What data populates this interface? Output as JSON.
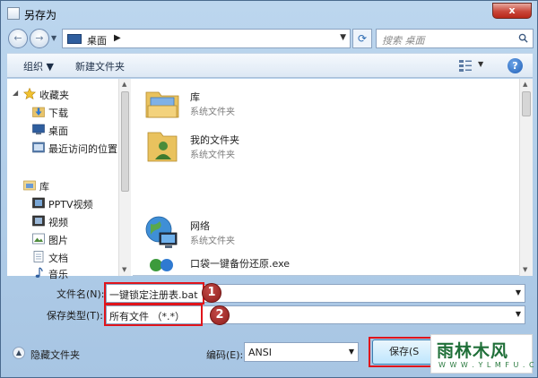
{
  "window": {
    "title": "另存为",
    "close_label": "x"
  },
  "address": {
    "back_label": "←",
    "forward_label": "→",
    "path": "桌面",
    "separator": "▶",
    "search_placeholder": "搜索 桌面"
  },
  "toolbar": {
    "organize": "组织 ▼",
    "new_folder": "新建文件夹",
    "help": "?"
  },
  "nav_pane": {
    "items": [
      {
        "label": "收藏夹",
        "icon": "star-icon"
      },
      {
        "label": "下载",
        "icon": "download-folder-icon"
      },
      {
        "label": "桌面",
        "icon": "desktop-icon"
      },
      {
        "label": "最近访问的位置",
        "icon": "recent-places-icon"
      },
      {
        "label": "库",
        "icon": "library-icon"
      },
      {
        "label": "PPTV视频",
        "icon": "video-folder-icon"
      },
      {
        "label": "视频",
        "icon": "video-icon"
      },
      {
        "label": "图片",
        "icon": "pictures-icon"
      },
      {
        "label": "文档",
        "icon": "documents-icon"
      },
      {
        "label": "音乐",
        "icon": "music-icon"
      }
    ]
  },
  "files": [
    {
      "name": "库",
      "type": "系统文件夹",
      "icon": "library-folder-icon"
    },
    {
      "name": "我的文件夹",
      "type": "系统文件夹",
      "icon": "user-folder-icon"
    },
    {
      "name": "网络",
      "type": "系统文件夹",
      "icon": "network-globe-icon"
    },
    {
      "name": "口袋一键备份还原.exe",
      "type": "",
      "icon": "exe-app-icon"
    }
  ],
  "form": {
    "filename_label": "文件名(N):",
    "filename_value": "一键锁定注册表.bat",
    "filetype_label": "保存类型(T):",
    "filetype_value": "所有文件 （*.*）",
    "callout_1": "1",
    "callout_2": "2"
  },
  "bottom": {
    "hide_folders_label": "隐藏文件夹",
    "encoding_label": "编码(E):",
    "encoding_value": "ANSI",
    "save_label": "保存(S"
  },
  "watermark": {
    "main": "雨林木风",
    "url": "W W W . Y L M F U . C O M"
  },
  "colors": {
    "accent_red": "#e0141b",
    "frame_blue": "#a7c5e3",
    "callout_red": "#8e1d1c"
  }
}
